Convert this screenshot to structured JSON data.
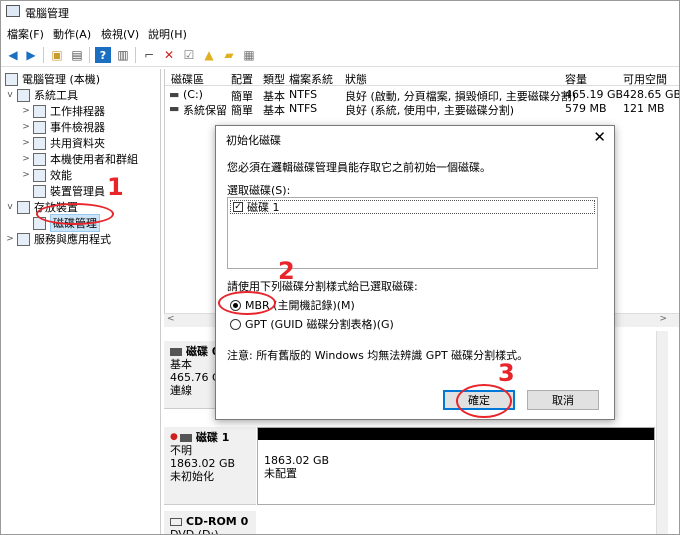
{
  "window": {
    "title": "電腦管理"
  },
  "menu": [
    "檔案(F)",
    "動作(A)",
    "檢視(V)",
    "說明(H)"
  ],
  "toolbar": {
    "icons": [
      "back-icon",
      "forward-icon",
      "up-folder-icon",
      "show-hide-tree-icon",
      "help-icon",
      "view-icon",
      "connect-icon",
      "delete-icon",
      "properties-icon",
      "export-icon",
      "folder-icon",
      "refresh-icon"
    ]
  },
  "tree": {
    "root": "電腦管理 (本機)",
    "system_tools": "系統工具",
    "task_scheduler": "工作排程器",
    "event_viewer": "事件檢視器",
    "shared_folders": "共用資料夾",
    "local_users": "本機使用者和群組",
    "performance": "效能",
    "device_manager": "裝置管理員",
    "storage": "存放裝置",
    "disk_mgmt": "磁碟管理",
    "services": "服務與應用程式"
  },
  "volumes": {
    "headers": [
      "磁碟區",
      "配置",
      "類型",
      "檔案系統",
      "狀態",
      "容量",
      "可用空間"
    ],
    "rows": [
      [
        "(C:)",
        "簡單",
        "基本",
        "NTFS",
        "良好 (啟動, 分頁檔案, 損毀傾印, 主要磁碟分割)",
        "465.19 GB",
        "428.65 GB"
      ],
      [
        "系統保留",
        "簡單",
        "基本",
        "NTFS",
        "良好 (系統, 使用中, 主要磁碟分割)",
        "579 MB",
        "121 MB"
      ]
    ]
  },
  "disks": {
    "disk0": {
      "name": "磁碟 0",
      "type": "基本",
      "size": "465.76 GB",
      "status": "連線"
    },
    "disk1": {
      "name": "磁碟 1",
      "type": "不明",
      "size": "1863.02 GB",
      "status": "未初始化",
      "part_size": "1863.02 GB",
      "part_status": "未配置"
    },
    "cdrom": {
      "name": "CD-ROM 0",
      "type": "DVD (D:)"
    }
  },
  "dialog": {
    "title": "初始化磁碟",
    "intro": "您必須在邏輯磁碟管理員能存取它之前初始一個磁碟。",
    "select_label": "選取磁碟(S):",
    "disk_item": "磁碟 1",
    "style_label": "請使用下列磁碟分割樣式給已選取磁碟:",
    "mbr": "MBR (主開機記錄)(M)",
    "gpt": "GPT (GUID 磁碟分割表格)(G)",
    "note": "注意: 所有舊版的 Windows 均無法辨識 GPT 磁碟分割樣式。",
    "ok": "確定",
    "cancel": "取消"
  },
  "annotations": [
    "1",
    "2",
    "3"
  ],
  "colors": {
    "annotation": "#e8252b",
    "selection": "#cce4f7",
    "default_button": "#0078d7"
  }
}
